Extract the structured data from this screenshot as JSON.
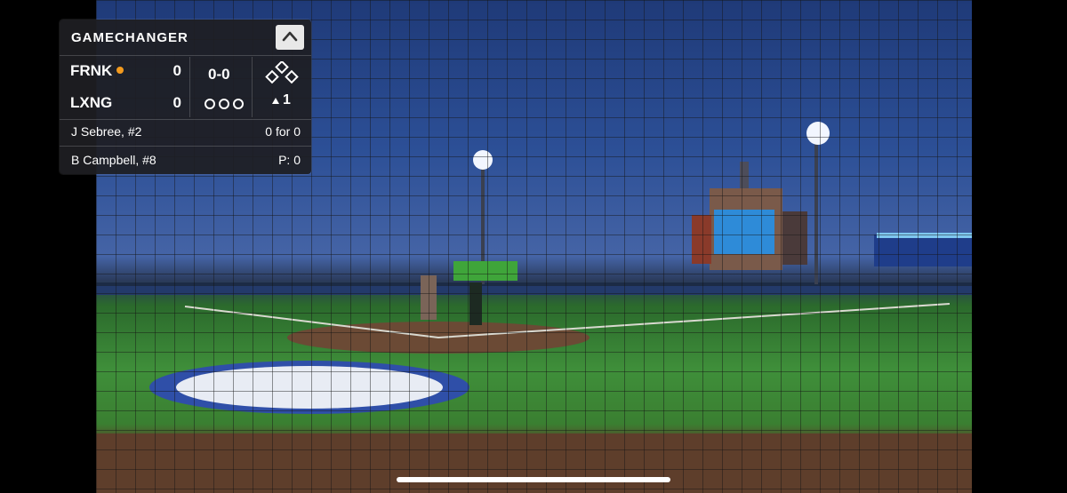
{
  "app": {
    "brand": "GAMECHANGER"
  },
  "teams": [
    {
      "abbr": "FRNK",
      "score": "0",
      "has_possession": true
    },
    {
      "abbr": "LXNG",
      "score": "0",
      "has_possession": false
    }
  ],
  "game_state": {
    "count": "0-0",
    "inning": "1",
    "inning_half": "top",
    "outs": 0
  },
  "batter": {
    "name": "J Sebree, #2",
    "stat": "0 for 0"
  },
  "pitcher": {
    "name": "B Campbell, #8",
    "stat": "P: 0"
  },
  "icons": {
    "collapse": "chevron-up-icon",
    "bases": "bases-diamond-icon",
    "inning": "triangle-up-icon",
    "possession": "possession-dot"
  },
  "colors": {
    "possession": "#f39a1e",
    "panel": "#1e1e22"
  }
}
